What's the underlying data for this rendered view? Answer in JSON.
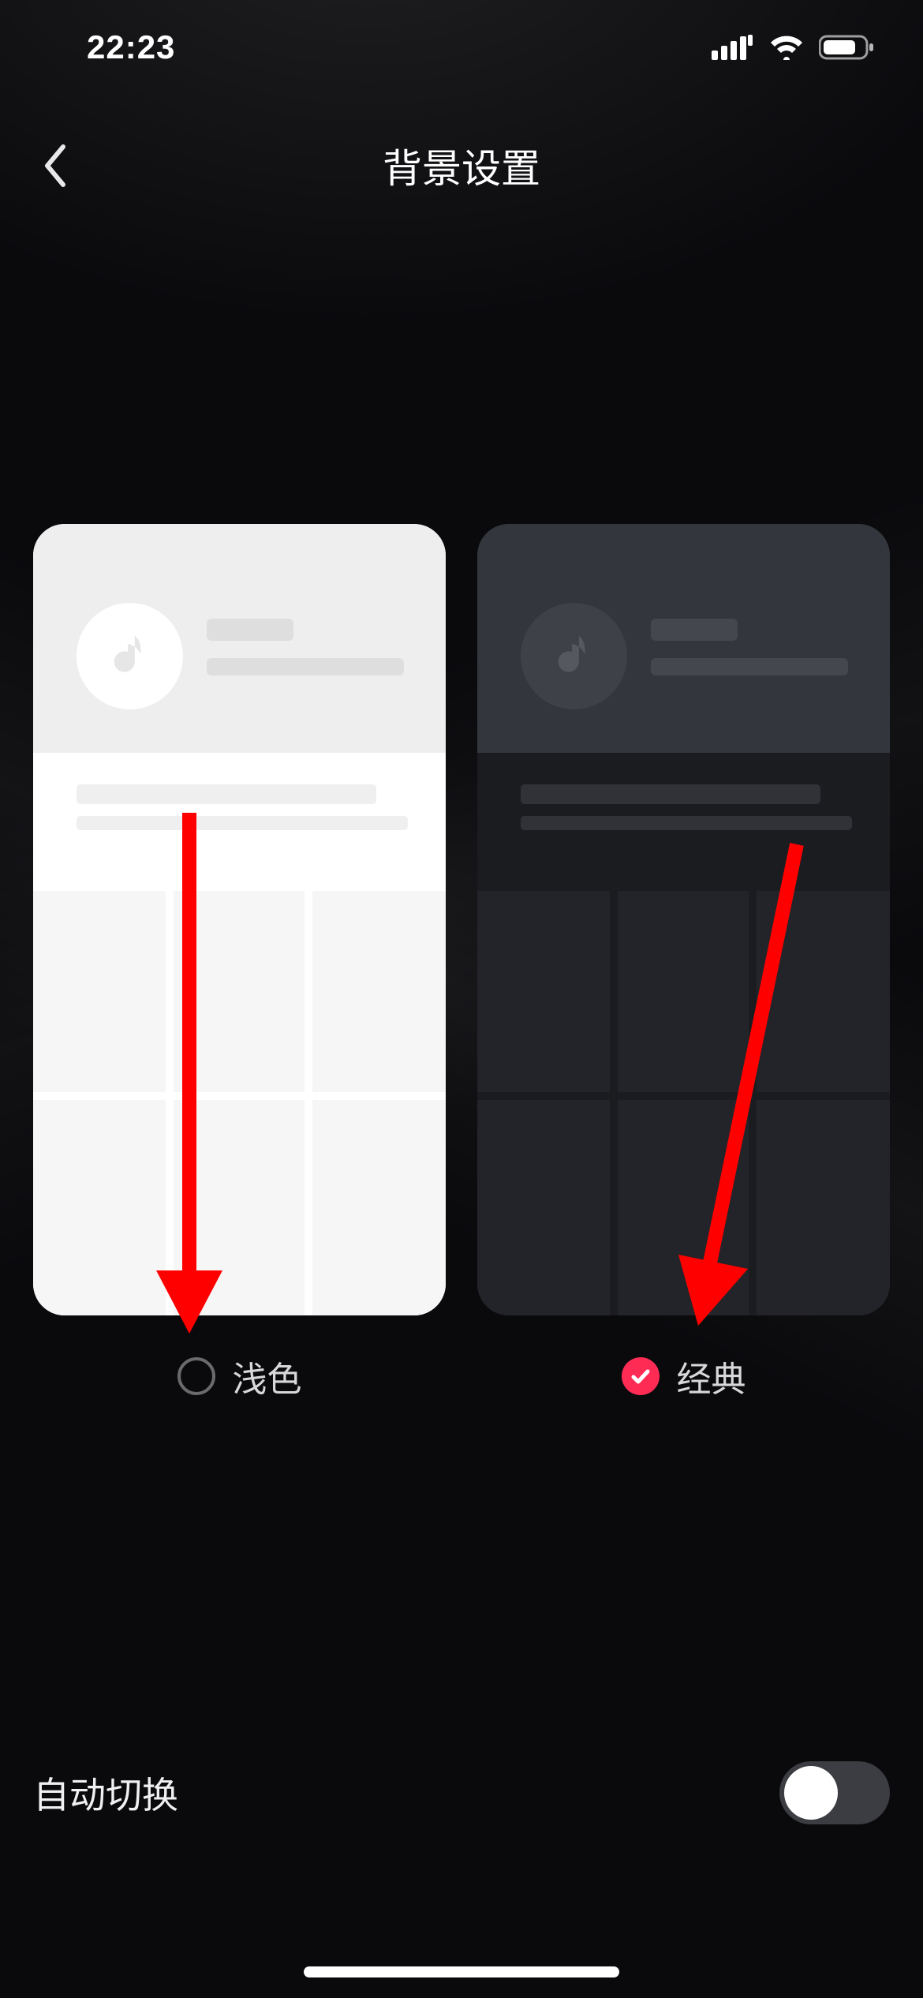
{
  "status": {
    "time": "22:23"
  },
  "header": {
    "title": "背景设置"
  },
  "themes": {
    "options": [
      {
        "key": "light",
        "label": "浅色",
        "selected": false
      },
      {
        "key": "classic",
        "label": "经典",
        "selected": true
      }
    ]
  },
  "auto_switch": {
    "label": "自动切换",
    "enabled": false
  },
  "colors": {
    "accent": "#fe2c55",
    "annotation": "#ff0000"
  }
}
